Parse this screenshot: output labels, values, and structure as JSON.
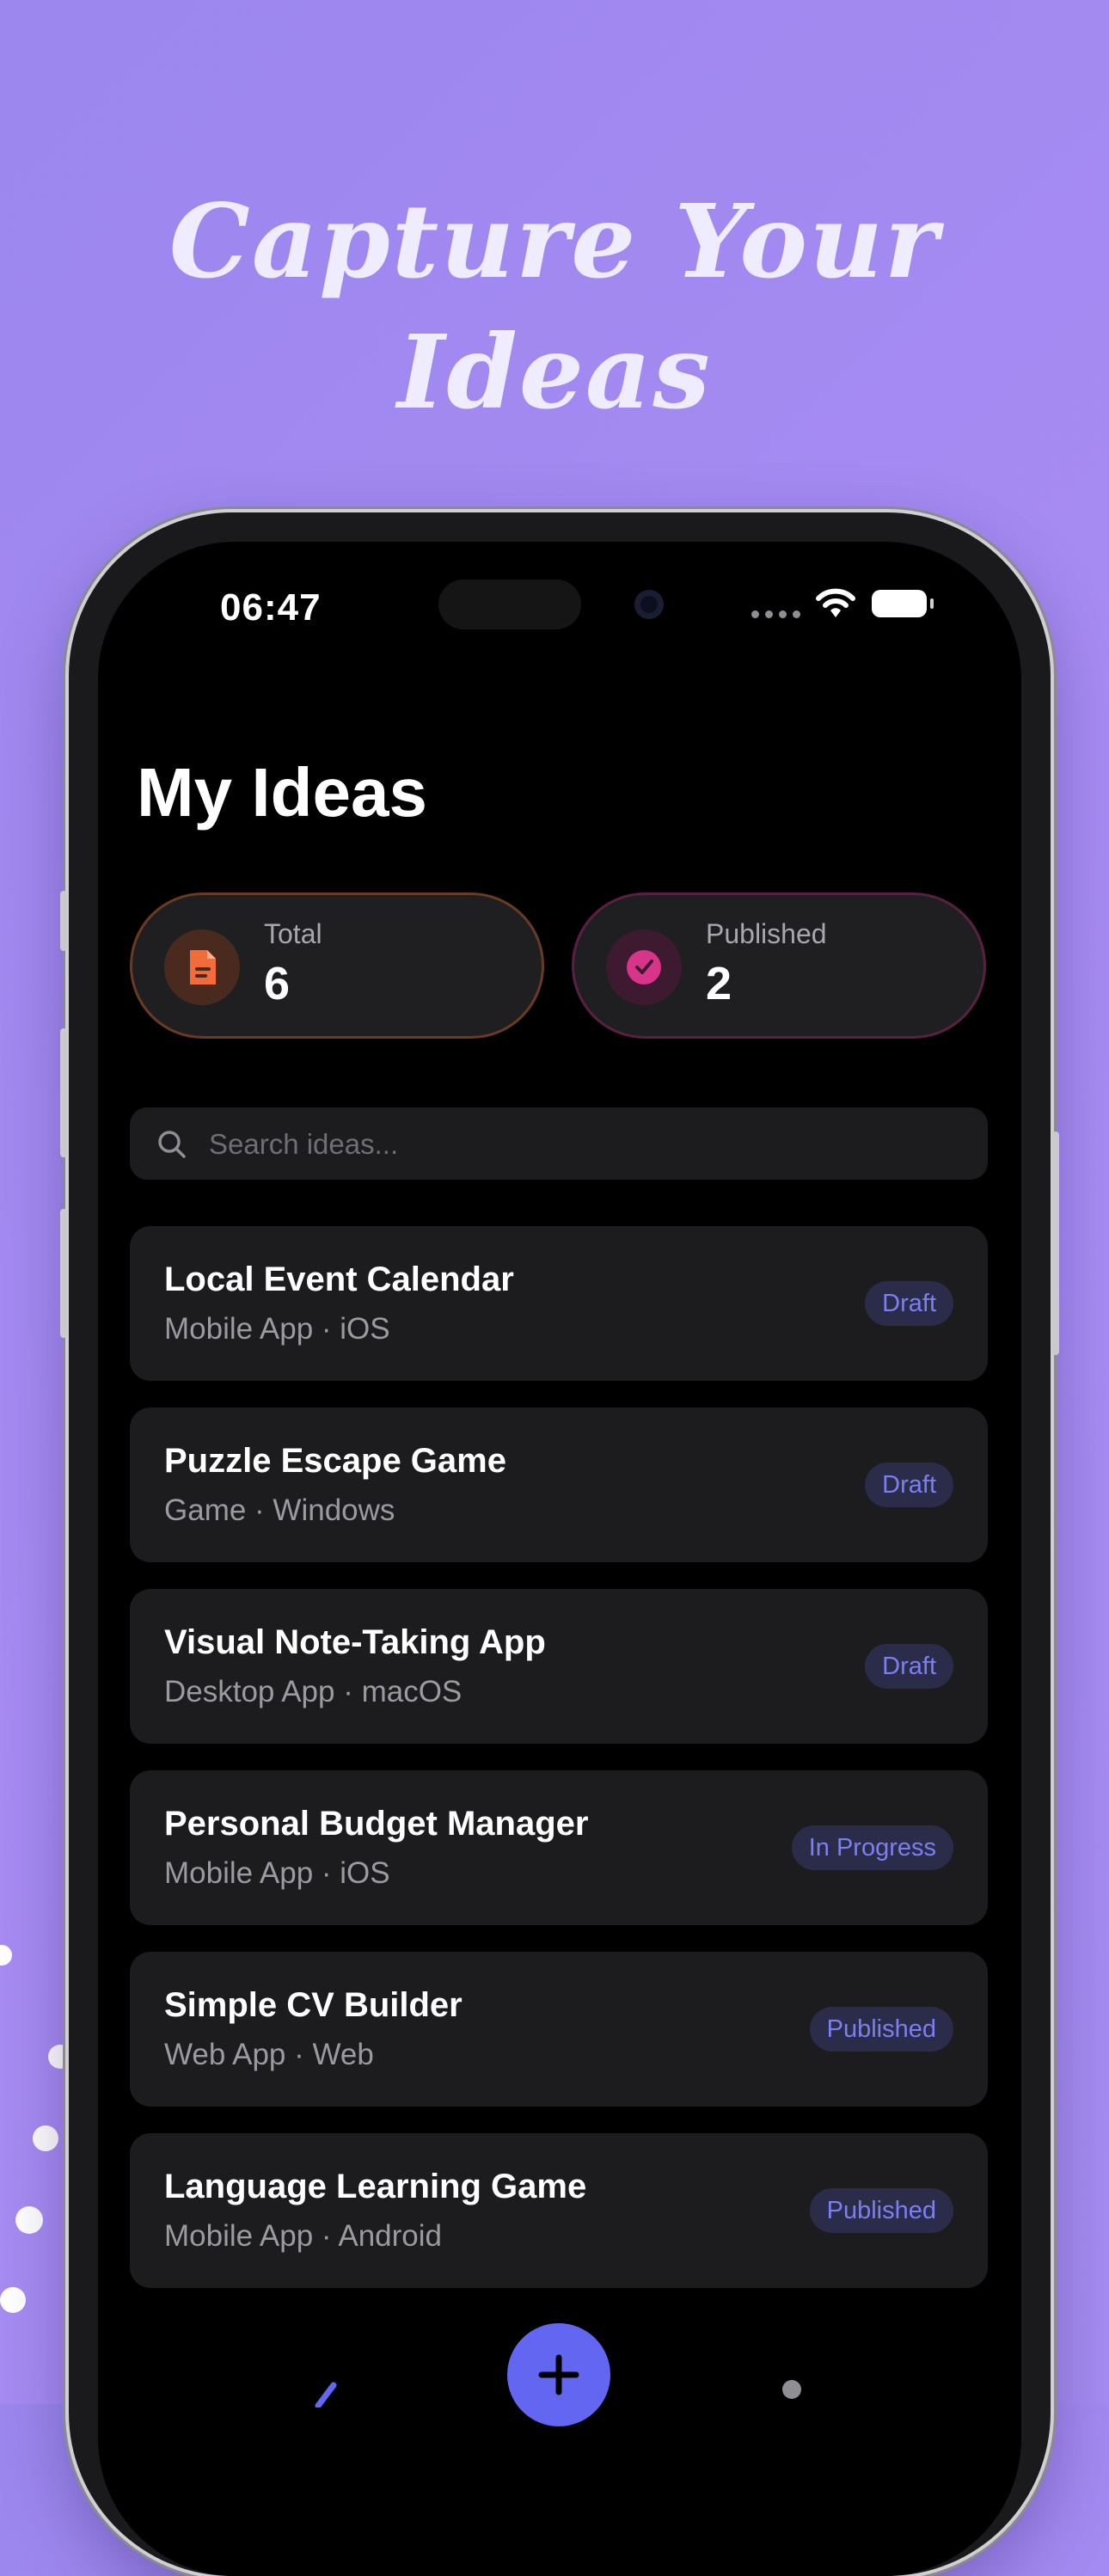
{
  "promo": {
    "headline_line1": "Capture Your",
    "headline_line2": "Ideas"
  },
  "status_bar": {
    "time": "06:47"
  },
  "page": {
    "title": "My Ideas"
  },
  "stats": {
    "total": {
      "label": "Total",
      "value": "6",
      "icon": "document-icon",
      "color": "#f26b3a"
    },
    "published": {
      "label": "Published",
      "value": "2",
      "icon": "check-circle-icon",
      "color": "#d8348a"
    }
  },
  "search": {
    "placeholder": "Search ideas...",
    "value": ""
  },
  "ideas": [
    {
      "title": "Local Event Calendar",
      "category": "Mobile App",
      "platform": "iOS",
      "status": "Draft"
    },
    {
      "title": "Puzzle Escape Game",
      "category": "Game",
      "platform": "Windows",
      "status": "Draft"
    },
    {
      "title": "Visual Note-Taking App",
      "category": "Desktop App",
      "platform": "macOS",
      "status": "Draft"
    },
    {
      "title": "Personal Budget Manager",
      "category": "Mobile App",
      "platform": "iOS",
      "status": "In Progress"
    },
    {
      "title": "Simple CV Builder",
      "category": "Web App",
      "platform": "Web",
      "status": "Published"
    },
    {
      "title": "Language Learning Game",
      "category": "Mobile App",
      "platform": "Android",
      "status": "Published"
    }
  ],
  "meta_separator": " · ",
  "colors": {
    "accent": "#6366f1",
    "badge_text": "#7c7ff2",
    "background": "#000000",
    "card": "#1c1c1e"
  }
}
